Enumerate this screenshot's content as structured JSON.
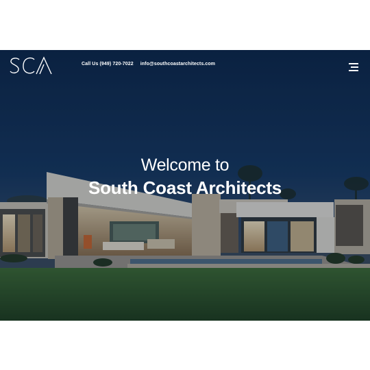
{
  "header": {
    "logo_text": "SCA",
    "phone_label": "Call Us (949) 720-7022",
    "email_label": "info@southcoastarchitects.com",
    "menu_icon": "hamburger-menu-icon"
  },
  "hero": {
    "line1": "Welcome to",
    "line2": "South Coast Architects",
    "image": "modern-house-at-dusk"
  },
  "colors": {
    "sky": "#12325e",
    "text": "#ffffff",
    "lawn": "#2f5a2a"
  }
}
